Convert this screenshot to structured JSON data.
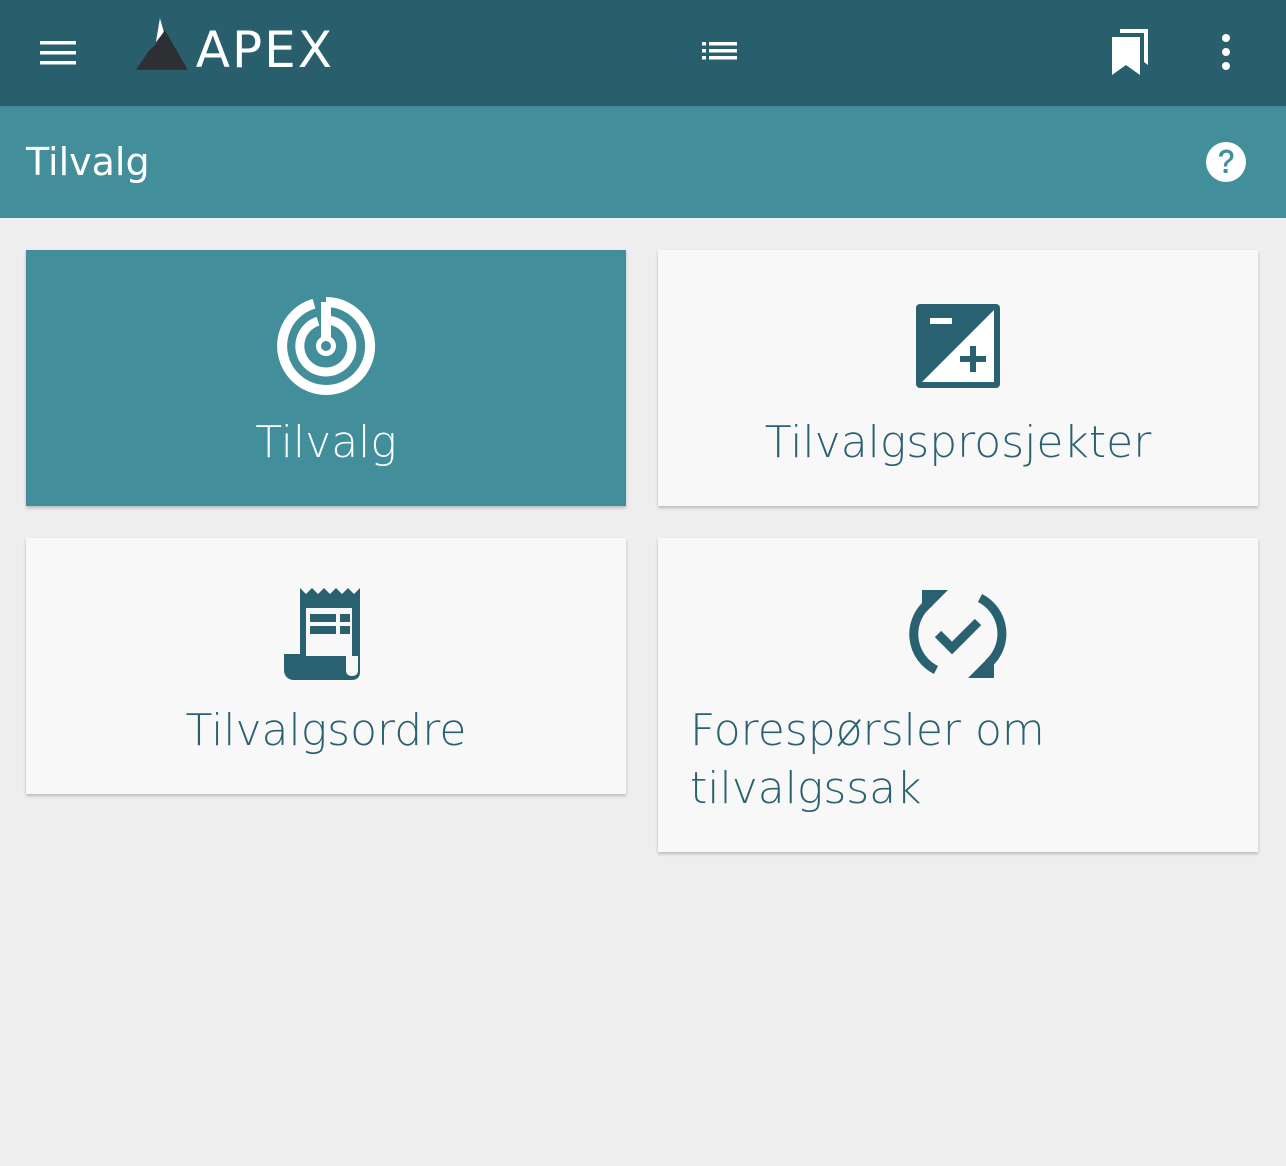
{
  "header": {
    "brand": "APEX",
    "menu_icon": "hamburger-menu-icon",
    "list_icon": "list-icon",
    "bookmark_icon": "bookmarks-icon",
    "more_icon": "more-vertical-icon"
  },
  "subheader": {
    "title": "Tilvalg",
    "help_icon": "help-circle-icon"
  },
  "tiles": [
    {
      "label": "Tilvalg",
      "icon": "target-icon",
      "active": true
    },
    {
      "label": "Tilvalgsprosjekter",
      "icon": "exposure-plus-minus-icon",
      "active": false
    },
    {
      "label": "Tilvalgsordre",
      "icon": "receipt-icon",
      "active": false
    },
    {
      "label": "Forespørsler om tilvalgssak",
      "icon": "sync-check-icon",
      "active": false
    }
  ],
  "colors": {
    "appbar": "#295f6d",
    "subbar": "#428e9a",
    "background": "#eeeeee",
    "tile": "#f8f8f8",
    "accent_text": "#2a6170"
  }
}
